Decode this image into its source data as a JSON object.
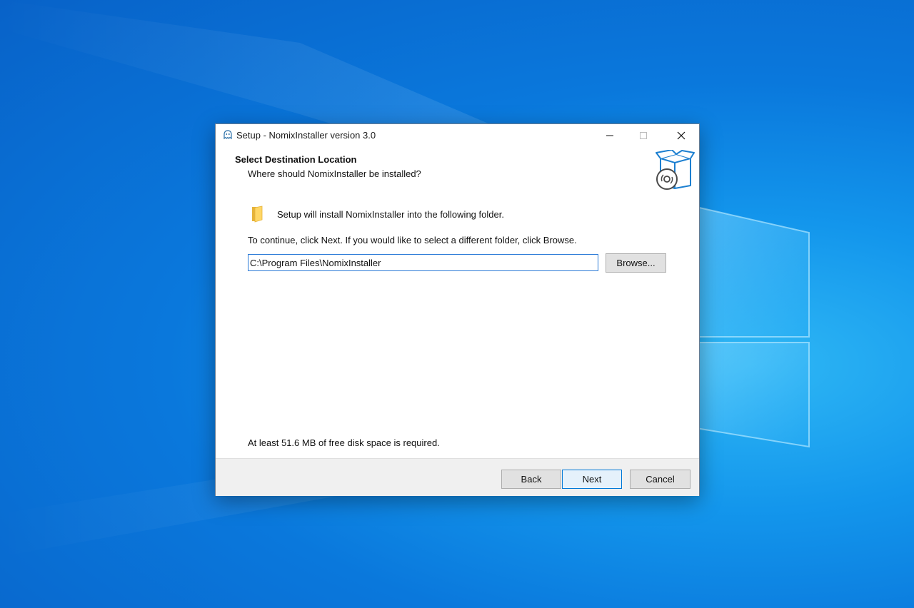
{
  "window": {
    "title": "Setup - NomixInstaller version 3.0",
    "app_icon": "installer-app-icon",
    "controls": {
      "minimize": "minimize-icon",
      "maximize": "maximize-icon",
      "close": "close-icon"
    }
  },
  "header": {
    "title": "Select Destination Location",
    "subtitle": "Where should NomixInstaller be installed?",
    "icon": "install-box-disc-icon"
  },
  "body": {
    "folder_icon": "folder-icon",
    "install_message": "Setup will install NomixInstaller into the following folder.",
    "continue_message": "To continue, click Next. If you would like to select a different folder, click Browse.",
    "path_value": "C:\\Program Files\\NomixInstaller",
    "browse_label": "Browse...",
    "disk_space_message": "At least 51.6 MB of free disk space is required."
  },
  "footer": {
    "back_label": "Back",
    "next_label": "Next",
    "cancel_label": "Cancel"
  },
  "colors": {
    "desktop_blue": "#0a78dc",
    "accent": "#0078d7",
    "footer_bg": "#f0f0f0",
    "button_bg": "#e1e1e1"
  }
}
